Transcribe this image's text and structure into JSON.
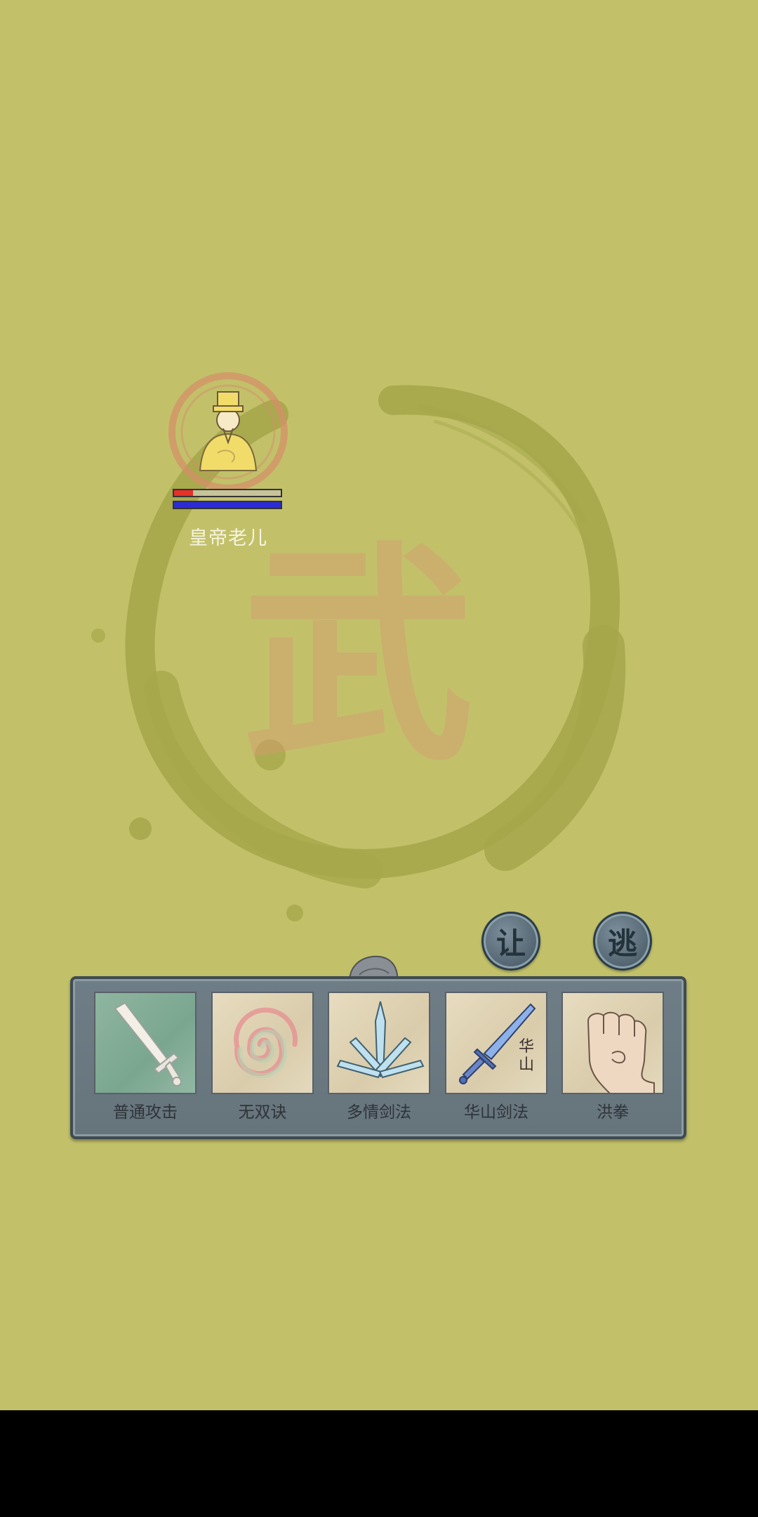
{
  "enemy": {
    "name": "皇帝老儿",
    "hp_fraction": 0.18,
    "mp_fraction": 1.0
  },
  "actions": {
    "yield_label": "让",
    "flee_label": "逃"
  },
  "background": {
    "calligraphy_char": "武"
  },
  "skills": [
    {
      "label": "普通攻击",
      "icon": "sword-icon",
      "active": true
    },
    {
      "label": "无双诀",
      "icon": "spiral-icon",
      "active": false
    },
    {
      "label": "多情剑法",
      "icon": "crystal-blades-icon",
      "active": false
    },
    {
      "label": "华山剑法",
      "icon": "huashan-sword-icon",
      "active": false,
      "badge": "华山"
    },
    {
      "label": "洪拳",
      "icon": "fist-icon",
      "active": false
    }
  ],
  "colors": {
    "background": "#c2c16a",
    "hp": "#e53128",
    "mp": "#2b2bd8",
    "panel": "#6f7d86"
  }
}
